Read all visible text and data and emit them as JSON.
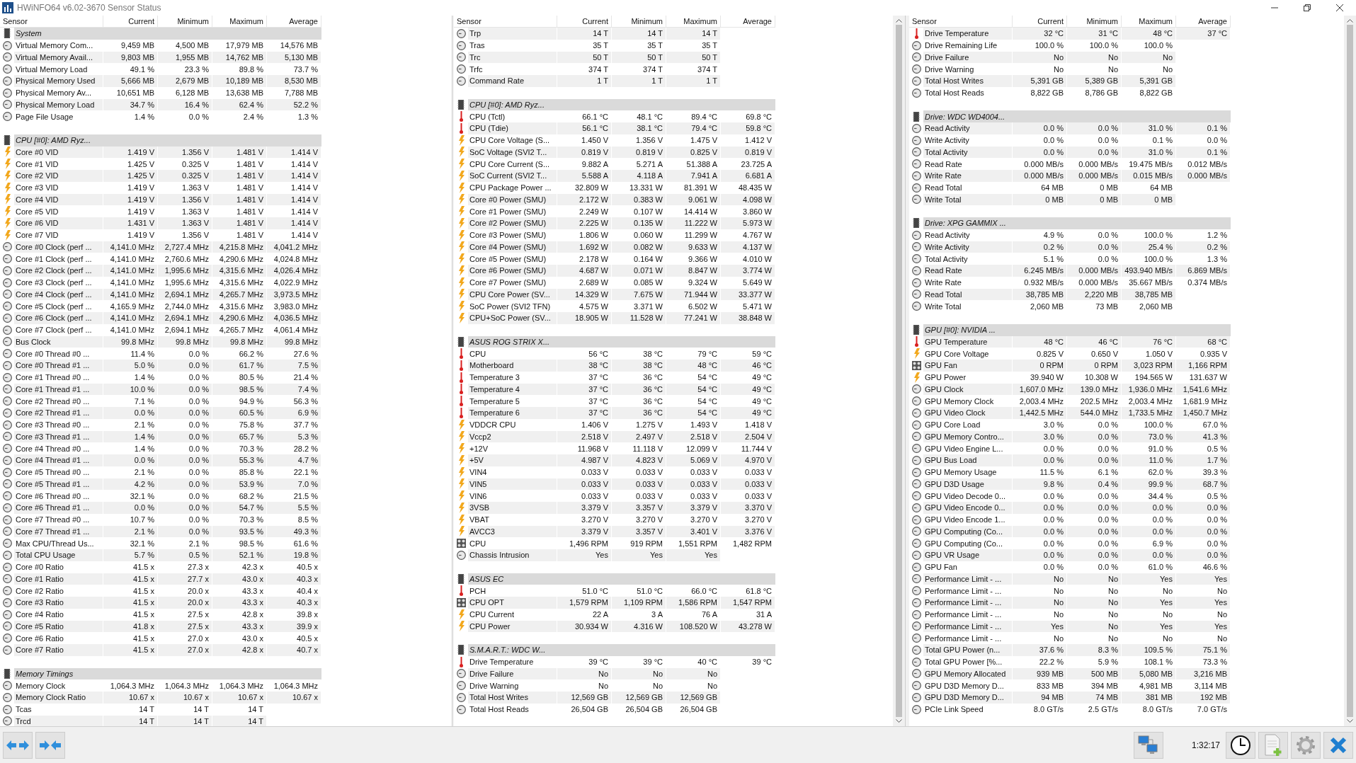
{
  "window": {
    "title": "HWiNFO64 v6.02-3670 Sensor Status"
  },
  "panels": [
    {
      "columns": [
        "Sensor",
        "Current",
        "Minimum",
        "Maximum",
        "Average"
      ],
      "rows": [
        {
          "kind": "group",
          "name": "System"
        },
        {
          "kind": "clock",
          "name": "Virtual Memory Com...",
          "values": [
            "9,459 MB",
            "4,500 MB",
            "17,979 MB",
            "14,576 MB"
          ]
        },
        {
          "kind": "clock",
          "name": "Virtual Memory Avail...",
          "values": [
            "9,803 MB",
            "1,955 MB",
            "14,762 MB",
            "5,130 MB"
          ]
        },
        {
          "kind": "clock",
          "name": "Virtual Memory Load",
          "values": [
            "49.1 %",
            "23.3 %",
            "89.8 %",
            "73.7 %"
          ]
        },
        {
          "kind": "clock",
          "name": "Physical Memory Used",
          "values": [
            "5,666 MB",
            "2,679 MB",
            "10,189 MB",
            "8,530 MB"
          ]
        },
        {
          "kind": "clock",
          "name": "Physical Memory Av...",
          "values": [
            "10,651 MB",
            "6,128 MB",
            "13,638 MB",
            "7,788 MB"
          ]
        },
        {
          "kind": "clock",
          "name": "Physical Memory Load",
          "values": [
            "34.7 %",
            "16.4 %",
            "62.4 %",
            "52.2 %"
          ]
        },
        {
          "kind": "clock",
          "name": "Page File Usage",
          "values": [
            "1.4 %",
            "0.0 %",
            "2.4 %",
            "1.3 %"
          ]
        },
        {
          "kind": "spacer"
        },
        {
          "kind": "group",
          "name": "CPU [#0]: AMD Ryz..."
        },
        {
          "kind": "power",
          "name": "Core #0 VID",
          "values": [
            "1.419 V",
            "1.356 V",
            "1.481 V",
            "1.414 V"
          ]
        },
        {
          "kind": "power",
          "name": "Core #1 VID",
          "values": [
            "1.425 V",
            "0.325 V",
            "1.481 V",
            "1.414 V"
          ]
        },
        {
          "kind": "power",
          "name": "Core #2 VID",
          "values": [
            "1.425 V",
            "0.325 V",
            "1.481 V",
            "1.414 V"
          ]
        },
        {
          "kind": "power",
          "name": "Core #3 VID",
          "values": [
            "1.419 V",
            "1.363 V",
            "1.481 V",
            "1.414 V"
          ]
        },
        {
          "kind": "power",
          "name": "Core #4 VID",
          "values": [
            "1.419 V",
            "1.356 V",
            "1.481 V",
            "1.414 V"
          ]
        },
        {
          "kind": "power",
          "name": "Core #5 VID",
          "values": [
            "1.419 V",
            "1.363 V",
            "1.481 V",
            "1.414 V"
          ]
        },
        {
          "kind": "power",
          "name": "Core #6 VID",
          "values": [
            "1.431 V",
            "1.363 V",
            "1.481 V",
            "1.414 V"
          ]
        },
        {
          "kind": "power",
          "name": "Core #7 VID",
          "values": [
            "1.419 V",
            "1.356 V",
            "1.481 V",
            "1.414 V"
          ]
        },
        {
          "kind": "clock",
          "name": "Core #0 Clock (perf ...",
          "values": [
            "4,141.0 MHz",
            "2,727.4 MHz",
            "4,215.8 MHz",
            "4,041.2 MHz"
          ]
        },
        {
          "kind": "clock",
          "name": "Core #1 Clock (perf ...",
          "values": [
            "4,141.0 MHz",
            "2,760.6 MHz",
            "4,290.6 MHz",
            "4,024.8 MHz"
          ]
        },
        {
          "kind": "clock",
          "name": "Core #2 Clock (perf ...",
          "values": [
            "4,141.0 MHz",
            "1,995.6 MHz",
            "4,315.6 MHz",
            "4,026.4 MHz"
          ]
        },
        {
          "kind": "clock",
          "name": "Core #3 Clock (perf ...",
          "values": [
            "4,141.0 MHz",
            "1,995.6 MHz",
            "4,315.6 MHz",
            "4,022.9 MHz"
          ]
        },
        {
          "kind": "clock",
          "name": "Core #4 Clock (perf ...",
          "values": [
            "4,141.0 MHz",
            "2,694.1 MHz",
            "4,265.7 MHz",
            "3,973.5 MHz"
          ]
        },
        {
          "kind": "clock",
          "name": "Core #5 Clock (perf ...",
          "values": [
            "4,165.9 MHz",
            "2,744.0 MHz",
            "4,315.6 MHz",
            "3,983.0 MHz"
          ]
        },
        {
          "kind": "clock",
          "name": "Core #6 Clock (perf ...",
          "values": [
            "4,141.0 MHz",
            "2,694.1 MHz",
            "4,290.6 MHz",
            "4,036.5 MHz"
          ]
        },
        {
          "kind": "clock",
          "name": "Core #7 Clock (perf ...",
          "values": [
            "4,141.0 MHz",
            "2,694.1 MHz",
            "4,265.7 MHz",
            "4,061.4 MHz"
          ]
        },
        {
          "kind": "clock",
          "name": "Bus Clock",
          "values": [
            "99.8 MHz",
            "99.8 MHz",
            "99.8 MHz",
            "99.8 MHz"
          ]
        },
        {
          "kind": "clock",
          "name": "Core #0 Thread #0 ...",
          "values": [
            "11.4 %",
            "0.0 %",
            "66.2 %",
            "27.6 %"
          ]
        },
        {
          "kind": "clock",
          "name": "Core #0 Thread #1 ...",
          "values": [
            "5.0 %",
            "0.0 %",
            "61.7 %",
            "7.5 %"
          ]
        },
        {
          "kind": "clock",
          "name": "Core #1 Thread #0 ...",
          "values": [
            "1.4 %",
            "0.0 %",
            "80.5 %",
            "21.4 %"
          ]
        },
        {
          "kind": "clock",
          "name": "Core #1 Thread #1 ...",
          "values": [
            "10.0 %",
            "0.0 %",
            "98.5 %",
            "7.4 %"
          ]
        },
        {
          "kind": "clock",
          "name": "Core #2 Thread #0 ...",
          "values": [
            "7.1 %",
            "0.0 %",
            "94.9 %",
            "56.3 %"
          ]
        },
        {
          "kind": "clock",
          "name": "Core #2 Thread #1 ...",
          "values": [
            "0.0 %",
            "0.0 %",
            "60.5 %",
            "6.9 %"
          ]
        },
        {
          "kind": "clock",
          "name": "Core #3 Thread #0 ...",
          "values": [
            "2.1 %",
            "0.0 %",
            "75.8 %",
            "37.7 %"
          ]
        },
        {
          "kind": "clock",
          "name": "Core #3 Thread #1 ...",
          "values": [
            "1.4 %",
            "0.0 %",
            "65.7 %",
            "5.3 %"
          ]
        },
        {
          "kind": "clock",
          "name": "Core #4 Thread #0 ...",
          "values": [
            "1.4 %",
            "0.0 %",
            "70.3 %",
            "28.2 %"
          ]
        },
        {
          "kind": "clock",
          "name": "Core #4 Thread #1 ...",
          "values": [
            "0.0 %",
            "0.0 %",
            "55.3 %",
            "4.7 %"
          ]
        },
        {
          "kind": "clock",
          "name": "Core #5 Thread #0 ...",
          "values": [
            "2.1 %",
            "0.0 %",
            "85.8 %",
            "22.1 %"
          ]
        },
        {
          "kind": "clock",
          "name": "Core #5 Thread #1 ...",
          "values": [
            "4.2 %",
            "0.0 %",
            "53.9 %",
            "7.0 %"
          ]
        },
        {
          "kind": "clock",
          "name": "Core #6 Thread #0 ...",
          "values": [
            "32.1 %",
            "0.0 %",
            "68.2 %",
            "21.5 %"
          ]
        },
        {
          "kind": "clock",
          "name": "Core #6 Thread #1 ...",
          "values": [
            "0.0 %",
            "0.0 %",
            "54.7 %",
            "5.5 %"
          ]
        },
        {
          "kind": "clock",
          "name": "Core #7 Thread #0 ...",
          "values": [
            "10.7 %",
            "0.0 %",
            "70.3 %",
            "8.5 %"
          ]
        },
        {
          "kind": "clock",
          "name": "Core #7 Thread #1 ...",
          "values": [
            "2.1 %",
            "0.0 %",
            "93.5 %",
            "49.3 %"
          ]
        },
        {
          "kind": "clock",
          "name": "Max CPU/Thread Us...",
          "values": [
            "32.1 %",
            "2.1 %",
            "98.5 %",
            "61.6 %"
          ]
        },
        {
          "kind": "clock",
          "name": "Total CPU Usage",
          "values": [
            "5.7 %",
            "0.5 %",
            "52.1 %",
            "19.8 %"
          ]
        },
        {
          "kind": "clock",
          "name": "Core #0 Ratio",
          "values": [
            "41.5 x",
            "27.3 x",
            "42.3 x",
            "40.5 x"
          ]
        },
        {
          "kind": "clock",
          "name": "Core #1 Ratio",
          "values": [
            "41.5 x",
            "27.7 x",
            "43.0 x",
            "40.3 x"
          ]
        },
        {
          "kind": "clock",
          "name": "Core #2 Ratio",
          "values": [
            "41.5 x",
            "20.0 x",
            "43.3 x",
            "40.4 x"
          ]
        },
        {
          "kind": "clock",
          "name": "Core #3 Ratio",
          "values": [
            "41.5 x",
            "20.0 x",
            "43.3 x",
            "40.3 x"
          ]
        },
        {
          "kind": "clock",
          "name": "Core #4 Ratio",
          "values": [
            "41.5 x",
            "27.5 x",
            "42.8 x",
            "39.8 x"
          ]
        },
        {
          "kind": "clock",
          "name": "Core #5 Ratio",
          "values": [
            "41.8 x",
            "27.5 x",
            "43.3 x",
            "39.9 x"
          ]
        },
        {
          "kind": "clock",
          "name": "Core #6 Ratio",
          "values": [
            "41.5 x",
            "27.0 x",
            "43.0 x",
            "40.5 x"
          ]
        },
        {
          "kind": "clock",
          "name": "Core #7 Ratio",
          "values": [
            "41.5 x",
            "27.0 x",
            "42.8 x",
            "40.7 x"
          ]
        },
        {
          "kind": "spacer"
        },
        {
          "kind": "group",
          "name": "Memory Timings"
        },
        {
          "kind": "clock",
          "name": "Memory Clock",
          "values": [
            "1,064.3 MHz",
            "1,064.3 MHz",
            "1,064.3 MHz",
            "1,064.3 MHz"
          ]
        },
        {
          "kind": "clock",
          "name": "Memory Clock Ratio",
          "values": [
            "10.67 x",
            "10.67 x",
            "10.67 x",
            "10.67 x"
          ]
        },
        {
          "kind": "clock",
          "name": "Tcas",
          "values": [
            "14 T",
            "14 T",
            "14 T"
          ]
        },
        {
          "kind": "clock",
          "name": "Trcd",
          "values": [
            "14 T",
            "14 T",
            "14 T"
          ]
        }
      ]
    },
    {
      "columns": [
        "Sensor",
        "Current",
        "Minimum",
        "Maximum",
        "Average"
      ],
      "rows": [
        {
          "kind": "clock",
          "name": "Trp",
          "values": [
            "14 T",
            "14 T",
            "14 T"
          ]
        },
        {
          "kind": "clock",
          "name": "Tras",
          "values": [
            "35 T",
            "35 T",
            "35 T"
          ]
        },
        {
          "kind": "clock",
          "name": "Trc",
          "values": [
            "50 T",
            "50 T",
            "50 T"
          ]
        },
        {
          "kind": "clock",
          "name": "Trfc",
          "values": [
            "374 T",
            "374 T",
            "374 T"
          ]
        },
        {
          "kind": "clock",
          "name": "Command Rate",
          "values": [
            "1 T",
            "1 T",
            "1 T"
          ]
        },
        {
          "kind": "spacer"
        },
        {
          "kind": "group",
          "name": "CPU [#0]: AMD Ryz..."
        },
        {
          "kind": "temp",
          "name": "CPU (Tctl)",
          "values": [
            "66.1 °C",
            "48.1 °C",
            "89.4 °C",
            "69.8 °C"
          ]
        },
        {
          "kind": "temp",
          "name": "CPU (Tdie)",
          "values": [
            "56.1 °C",
            "38.1 °C",
            "79.4 °C",
            "59.8 °C"
          ]
        },
        {
          "kind": "power",
          "name": "CPU Core Voltage (S...",
          "values": [
            "1.450 V",
            "1.356 V",
            "1.475 V",
            "1.412 V"
          ]
        },
        {
          "kind": "power",
          "name": "SoC Voltage (SVI2 T...",
          "values": [
            "0.819 V",
            "0.819 V",
            "0.825 V",
            "0.819 V"
          ]
        },
        {
          "kind": "power",
          "name": "CPU Core Current (S...",
          "values": [
            "9.882 A",
            "5.271 A",
            "51.388 A",
            "23.725 A"
          ]
        },
        {
          "kind": "power",
          "name": "SoC Current (SVI2 T...",
          "values": [
            "5.588 A",
            "4.118 A",
            "7.941 A",
            "6.681 A"
          ]
        },
        {
          "kind": "power",
          "name": "CPU Package Power ...",
          "values": [
            "32.809 W",
            "13.331 W",
            "81.391 W",
            "48.435 W"
          ]
        },
        {
          "kind": "power",
          "name": "Core #0 Power (SMU)",
          "values": [
            "2.172 W",
            "0.383 W",
            "9.061 W",
            "4.098 W"
          ]
        },
        {
          "kind": "power",
          "name": "Core #1 Power (SMU)",
          "values": [
            "2.249 W",
            "0.107 W",
            "14.414 W",
            "3.860 W"
          ]
        },
        {
          "kind": "power",
          "name": "Core #2 Power (SMU)",
          "values": [
            "2.225 W",
            "0.135 W",
            "11.222 W",
            "5.973 W"
          ]
        },
        {
          "kind": "power",
          "name": "Core #3 Power (SMU)",
          "values": [
            "1.806 W",
            "0.060 W",
            "11.299 W",
            "4.767 W"
          ]
        },
        {
          "kind": "power",
          "name": "Core #4 Power (SMU)",
          "values": [
            "1.692 W",
            "0.082 W",
            "9.633 W",
            "4.137 W"
          ]
        },
        {
          "kind": "power",
          "name": "Core #5 Power (SMU)",
          "values": [
            "2.178 W",
            "0.164 W",
            "9.366 W",
            "4.010 W"
          ]
        },
        {
          "kind": "power",
          "name": "Core #6 Power (SMU)",
          "values": [
            "4.687 W",
            "0.071 W",
            "8.847 W",
            "3.774 W"
          ]
        },
        {
          "kind": "power",
          "name": "Core #7 Power (SMU)",
          "values": [
            "2.689 W",
            "0.085 W",
            "9.324 W",
            "5.649 W"
          ]
        },
        {
          "kind": "power",
          "name": "CPU Core Power (SV...",
          "values": [
            "14.329 W",
            "7.675 W",
            "71.944 W",
            "33.377 W"
          ]
        },
        {
          "kind": "power",
          "name": "SoC Power (SVI2 TFN)",
          "values": [
            "4.575 W",
            "3.371 W",
            "6.502 W",
            "5.471 W"
          ]
        },
        {
          "kind": "power",
          "name": "CPU+SoC Power (SV...",
          "values": [
            "18.905 W",
            "11.528 W",
            "77.241 W",
            "38.848 W"
          ]
        },
        {
          "kind": "spacer"
        },
        {
          "kind": "group",
          "name": "ASUS ROG STRIX X..."
        },
        {
          "kind": "temp",
          "name": "CPU",
          "values": [
            "56 °C",
            "38 °C",
            "79 °C",
            "59 °C"
          ]
        },
        {
          "kind": "temp",
          "name": "Motherboard",
          "values": [
            "38 °C",
            "38 °C",
            "48 °C",
            "46 °C"
          ]
        },
        {
          "kind": "temp",
          "name": "Temperature 3",
          "values": [
            "37 °C",
            "36 °C",
            "54 °C",
            "49 °C"
          ]
        },
        {
          "kind": "temp",
          "name": "Temperature 4",
          "values": [
            "37 °C",
            "36 °C",
            "54 °C",
            "49 °C"
          ]
        },
        {
          "kind": "temp",
          "name": "Temperature 5",
          "values": [
            "37 °C",
            "36 °C",
            "54 °C",
            "49 °C"
          ]
        },
        {
          "kind": "temp",
          "name": "Temperature 6",
          "values": [
            "37 °C",
            "36 °C",
            "54 °C",
            "49 °C"
          ]
        },
        {
          "kind": "power",
          "name": "VDDCR CPU",
          "values": [
            "1.406 V",
            "1.275 V",
            "1.493 V",
            "1.418 V"
          ]
        },
        {
          "kind": "power",
          "name": "Vccp2",
          "values": [
            "2.518 V",
            "2.497 V",
            "2.518 V",
            "2.504 V"
          ]
        },
        {
          "kind": "power",
          "name": "+12V",
          "values": [
            "11.968 V",
            "11.118 V",
            "12.099 V",
            "11.744 V"
          ]
        },
        {
          "kind": "power",
          "name": "+5V",
          "values": [
            "4.987 V",
            "4.823 V",
            "5.069 V",
            "4.970 V"
          ]
        },
        {
          "kind": "power",
          "name": "VIN4",
          "values": [
            "0.033 V",
            "0.033 V",
            "0.033 V",
            "0.033 V"
          ]
        },
        {
          "kind": "power",
          "name": "VIN5",
          "values": [
            "0.033 V",
            "0.033 V",
            "0.033 V",
            "0.033 V"
          ]
        },
        {
          "kind": "power",
          "name": "VIN6",
          "values": [
            "0.033 V",
            "0.033 V",
            "0.033 V",
            "0.033 V"
          ]
        },
        {
          "kind": "power",
          "name": "3VSB",
          "values": [
            "3.379 V",
            "3.357 V",
            "3.379 V",
            "3.370 V"
          ]
        },
        {
          "kind": "power",
          "name": "VBAT",
          "values": [
            "3.270 V",
            "3.270 V",
            "3.270 V",
            "3.270 V"
          ]
        },
        {
          "kind": "power",
          "name": "AVCC3",
          "values": [
            "3.379 V",
            "3.357 V",
            "3.401 V",
            "3.376 V"
          ]
        },
        {
          "kind": "fan",
          "name": "CPU",
          "values": [
            "1,496 RPM",
            "919 RPM",
            "1,551 RPM",
            "1,482 RPM"
          ]
        },
        {
          "kind": "clock",
          "name": "Chassis Intrusion",
          "values": [
            "Yes",
            "Yes",
            "Yes"
          ]
        },
        {
          "kind": "spacer"
        },
        {
          "kind": "group",
          "name": "ASUS EC"
        },
        {
          "kind": "temp",
          "name": "PCH",
          "values": [
            "51.0 °C",
            "51.0 °C",
            "66.0 °C",
            "61.8 °C"
          ]
        },
        {
          "kind": "fan",
          "name": "CPU OPT",
          "values": [
            "1,579 RPM",
            "1,109 RPM",
            "1,586 RPM",
            "1,547 RPM"
          ]
        },
        {
          "kind": "power",
          "name": "CPU Current",
          "values": [
            "22 A",
            "3 A",
            "76 A",
            "31 A"
          ]
        },
        {
          "kind": "power",
          "name": "CPU Power",
          "values": [
            "30.934 W",
            "4.316 W",
            "108.520 W",
            "43.278 W"
          ]
        },
        {
          "kind": "spacer"
        },
        {
          "kind": "group",
          "name": "S.M.A.R.T.: WDC W..."
        },
        {
          "kind": "temp",
          "name": "Drive Temperature",
          "values": [
            "39 °C",
            "39 °C",
            "40 °C",
            "39 °C"
          ]
        },
        {
          "kind": "clock",
          "name": "Drive Failure",
          "values": [
            "No",
            "No",
            "No"
          ]
        },
        {
          "kind": "clock",
          "name": "Drive Warning",
          "values": [
            "No",
            "No",
            "No"
          ]
        },
        {
          "kind": "clock",
          "name": "Total Host Writes",
          "values": [
            "12,569 GB",
            "12,569 GB",
            "12,569 GB"
          ]
        },
        {
          "kind": "clock",
          "name": "Total Host Reads",
          "values": [
            "26,504 GB",
            "26,504 GB",
            "26,504 GB"
          ]
        }
      ]
    },
    {
      "columns": [
        "Sensor",
        "Current",
        "Minimum",
        "Maximum",
        "Average"
      ],
      "rows": [
        {
          "kind": "temp",
          "name": "Drive Temperature",
          "values": [
            "32 °C",
            "31 °C",
            "48 °C",
            "37 °C"
          ]
        },
        {
          "kind": "clock",
          "name": "Drive Remaining Life",
          "values": [
            "100.0 %",
            "100.0 %",
            "100.0 %"
          ]
        },
        {
          "kind": "clock",
          "name": "Drive Failure",
          "values": [
            "No",
            "No",
            "No"
          ]
        },
        {
          "kind": "clock",
          "name": "Drive Warning",
          "values": [
            "No",
            "No",
            "No"
          ]
        },
        {
          "kind": "clock",
          "name": "Total Host Writes",
          "values": [
            "5,391 GB",
            "5,389 GB",
            "5,391 GB"
          ]
        },
        {
          "kind": "clock",
          "name": "Total Host Reads",
          "values": [
            "8,822 GB",
            "8,786 GB",
            "8,822 GB"
          ]
        },
        {
          "kind": "spacer"
        },
        {
          "kind": "group",
          "name": "Drive: WDC WD4004..."
        },
        {
          "kind": "clock",
          "name": "Read Activity",
          "values": [
            "0.0 %",
            "0.0 %",
            "31.0 %",
            "0.1 %"
          ]
        },
        {
          "kind": "clock",
          "name": "Write Activity",
          "values": [
            "0.0 %",
            "0.0 %",
            "0.1 %",
            "0.0 %"
          ]
        },
        {
          "kind": "clock",
          "name": "Total Activity",
          "values": [
            "0.0 %",
            "0.0 %",
            "31.0 %",
            "0.1 %"
          ]
        },
        {
          "kind": "clock",
          "name": "Read Rate",
          "values": [
            "0.000 MB/s",
            "0.000 MB/s",
            "19.475 MB/s",
            "0.012 MB/s"
          ]
        },
        {
          "kind": "clock",
          "name": "Write Rate",
          "values": [
            "0.000 MB/s",
            "0.000 MB/s",
            "0.015 MB/s",
            "0.000 MB/s"
          ]
        },
        {
          "kind": "clock",
          "name": "Read Total",
          "values": [
            "64 MB",
            "0 MB",
            "64 MB"
          ]
        },
        {
          "kind": "clock",
          "name": "Write Total",
          "values": [
            "0 MB",
            "0 MB",
            "0 MB"
          ]
        },
        {
          "kind": "spacer"
        },
        {
          "kind": "group",
          "name": "Drive: XPG GAMMIX ..."
        },
        {
          "kind": "clock",
          "name": "Read Activity",
          "values": [
            "4.9 %",
            "0.0 %",
            "100.0 %",
            "1.2 %"
          ]
        },
        {
          "kind": "clock",
          "name": "Write Activity",
          "values": [
            "0.2 %",
            "0.0 %",
            "25.4 %",
            "0.2 %"
          ]
        },
        {
          "kind": "clock",
          "name": "Total Activity",
          "values": [
            "5.1 %",
            "0.0 %",
            "100.0 %",
            "1.3 %"
          ]
        },
        {
          "kind": "clock",
          "name": "Read Rate",
          "values": [
            "6.245 MB/s",
            "0.000 MB/s",
            "493.940 MB/s",
            "6.869 MB/s"
          ]
        },
        {
          "kind": "clock",
          "name": "Write Rate",
          "values": [
            "0.932 MB/s",
            "0.000 MB/s",
            "35.667 MB/s",
            "0.374 MB/s"
          ]
        },
        {
          "kind": "clock",
          "name": "Read Total",
          "values": [
            "38,785 MB",
            "2,220 MB",
            "38,785 MB"
          ]
        },
        {
          "kind": "clock",
          "name": "Write Total",
          "values": [
            "2,060 MB",
            "73 MB",
            "2,060 MB"
          ]
        },
        {
          "kind": "spacer"
        },
        {
          "kind": "group",
          "name": "GPU [#0]: NVIDIA ..."
        },
        {
          "kind": "temp",
          "name": "GPU Temperature",
          "values": [
            "48 °C",
            "46 °C",
            "76 °C",
            "68 °C"
          ]
        },
        {
          "kind": "power",
          "name": "GPU Core Voltage",
          "values": [
            "0.825 V",
            "0.650 V",
            "1.050 V",
            "0.935 V"
          ]
        },
        {
          "kind": "fan",
          "name": "GPU Fan",
          "values": [
            "0 RPM",
            "0 RPM",
            "3,023 RPM",
            "1,166 RPM"
          ]
        },
        {
          "kind": "power",
          "name": "GPU Power",
          "values": [
            "39.940 W",
            "10.308 W",
            "194.565 W",
            "131.637 W"
          ]
        },
        {
          "kind": "clock",
          "name": "GPU Clock",
          "values": [
            "1,607.0 MHz",
            "139.0 MHz",
            "1,936.0 MHz",
            "1,541.6 MHz"
          ]
        },
        {
          "kind": "clock",
          "name": "GPU Memory Clock",
          "values": [
            "2,003.4 MHz",
            "202.5 MHz",
            "2,003.4 MHz",
            "1,681.9 MHz"
          ]
        },
        {
          "kind": "clock",
          "name": "GPU Video Clock",
          "values": [
            "1,442.5 MHz",
            "544.0 MHz",
            "1,733.5 MHz",
            "1,450.7 MHz"
          ]
        },
        {
          "kind": "clock",
          "name": "GPU Core Load",
          "values": [
            "3.0 %",
            "0.0 %",
            "100.0 %",
            "67.0 %"
          ]
        },
        {
          "kind": "clock",
          "name": "GPU Memory Contro...",
          "values": [
            "3.0 %",
            "0.0 %",
            "73.0 %",
            "41.3 %"
          ]
        },
        {
          "kind": "clock",
          "name": "GPU Video Engine L...",
          "values": [
            "0.0 %",
            "0.0 %",
            "91.0 %",
            "0.5 %"
          ]
        },
        {
          "kind": "clock",
          "name": "GPU Bus Load",
          "values": [
            "0.0 %",
            "0.0 %",
            "11.0 %",
            "1.7 %"
          ]
        },
        {
          "kind": "clock",
          "name": "GPU Memory Usage",
          "values": [
            "11.5 %",
            "6.1 %",
            "62.0 %",
            "39.3 %"
          ]
        },
        {
          "kind": "clock",
          "name": "GPU D3D Usage",
          "values": [
            "9.8 %",
            "0.4 %",
            "99.9 %",
            "68.7 %"
          ]
        },
        {
          "kind": "clock",
          "name": "GPU Video Decode 0...",
          "values": [
            "0.0 %",
            "0.0 %",
            "34.4 %",
            "0.5 %"
          ]
        },
        {
          "kind": "clock",
          "name": "GPU Video Encode 0...",
          "values": [
            "0.0 %",
            "0.0 %",
            "0.0 %",
            "0.0 %"
          ]
        },
        {
          "kind": "clock",
          "name": "GPU Video Encode 1...",
          "values": [
            "0.0 %",
            "0.0 %",
            "0.0 %",
            "0.0 %"
          ]
        },
        {
          "kind": "clock",
          "name": "GPU Computing (Co...",
          "values": [
            "0.0 %",
            "0.0 %",
            "0.0 %",
            "0.0 %"
          ]
        },
        {
          "kind": "clock",
          "name": "GPU Computing (Co...",
          "values": [
            "0.0 %",
            "0.0 %",
            "6.9 %",
            "0.0 %"
          ]
        },
        {
          "kind": "clock",
          "name": "GPU VR Usage",
          "values": [
            "0.0 %",
            "0.0 %",
            "0.0 %",
            "0.0 %"
          ]
        },
        {
          "kind": "clock",
          "name": "GPU Fan",
          "values": [
            "0.0 %",
            "0.0 %",
            "61.0 %",
            "46.6 %"
          ]
        },
        {
          "kind": "clock",
          "name": "Performance Limit - ...",
          "values": [
            "No",
            "No",
            "Yes",
            "Yes"
          ]
        },
        {
          "kind": "clock",
          "name": "Performance Limit - ...",
          "values": [
            "No",
            "No",
            "No",
            "No"
          ]
        },
        {
          "kind": "clock",
          "name": "Performance Limit - ...",
          "values": [
            "No",
            "No",
            "Yes",
            "Yes"
          ]
        },
        {
          "kind": "clock",
          "name": "Performance Limit - ...",
          "values": [
            "No",
            "No",
            "No",
            "No"
          ]
        },
        {
          "kind": "clock",
          "name": "Performance Limit - ...",
          "values": [
            "Yes",
            "No",
            "Yes",
            "Yes"
          ]
        },
        {
          "kind": "clock",
          "name": "Performance Limit - ...",
          "values": [
            "No",
            "No",
            "No",
            "No"
          ]
        },
        {
          "kind": "clock",
          "name": "Total GPU Power (n...",
          "values": [
            "37.6 %",
            "8.3 %",
            "109.5 %",
            "75.1 %"
          ]
        },
        {
          "kind": "clock",
          "name": "Total GPU Power [%...",
          "values": [
            "22.2 %",
            "5.9 %",
            "108.1 %",
            "73.3 %"
          ]
        },
        {
          "kind": "clock",
          "name": "GPU Memory Allocated",
          "values": [
            "939 MB",
            "500 MB",
            "5,080 MB",
            "3,216 MB"
          ]
        },
        {
          "kind": "clock",
          "name": "GPU D3D Memory D...",
          "values": [
            "833 MB",
            "394 MB",
            "4,981 MB",
            "3,114 MB"
          ]
        },
        {
          "kind": "clock",
          "name": "GPU D3D Memory D...",
          "values": [
            "94 MB",
            "74 MB",
            "381 MB",
            "192 MB"
          ]
        },
        {
          "kind": "clock",
          "name": "PCIe Link Speed",
          "values": [
            "8.0 GT/s",
            "2.5 GT/s",
            "8.0 GT/s",
            "7.0 GT/s"
          ]
        }
      ]
    }
  ],
  "toolbar": {
    "time": "1:32:17"
  }
}
